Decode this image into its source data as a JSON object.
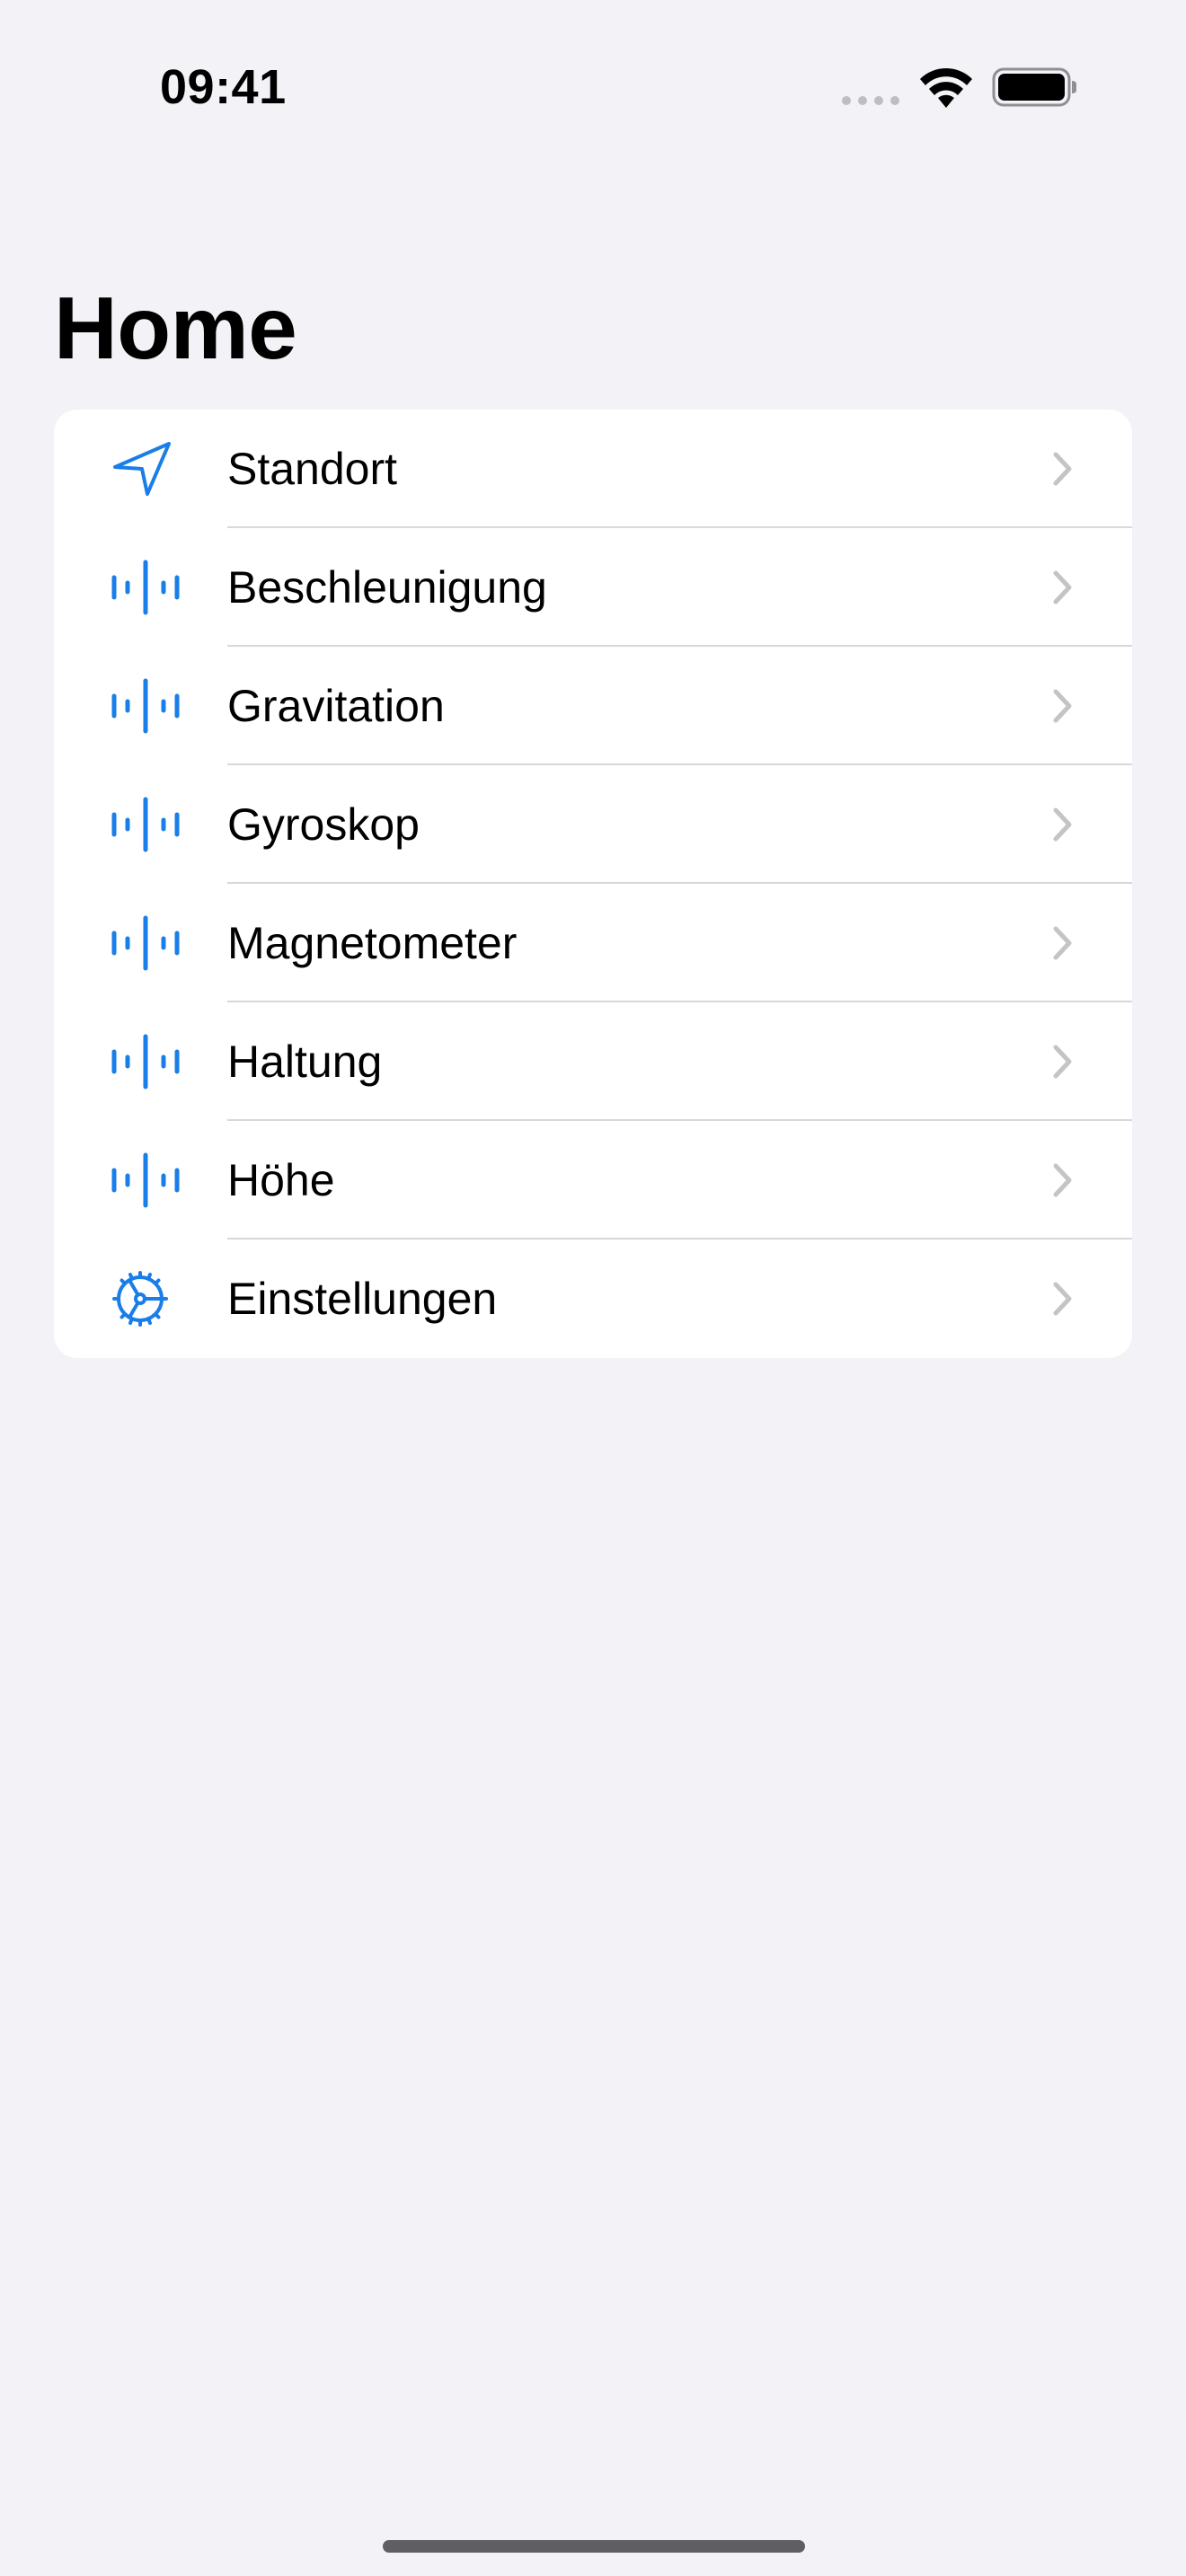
{
  "status_bar": {
    "time": "09:41"
  },
  "title": "Home",
  "colors": {
    "accent": "#1A7EE8",
    "background": "#F2F2F7",
    "card": "#FFFFFF",
    "chevron": "#C4C4C7",
    "divider": "#D7D7DC"
  },
  "items": [
    {
      "label": "Standort",
      "icon": "location-arrow-icon"
    },
    {
      "label": "Beschleunigung",
      "icon": "waveform-icon"
    },
    {
      "label": "Gravitation",
      "icon": "waveform-icon"
    },
    {
      "label": "Gyroskop",
      "icon": "waveform-icon"
    },
    {
      "label": "Magnetometer",
      "icon": "waveform-icon"
    },
    {
      "label": "Haltung",
      "icon": "waveform-icon"
    },
    {
      "label": "Höhe",
      "icon": "waveform-icon"
    },
    {
      "label": "Einstellungen",
      "icon": "gear-icon"
    }
  ]
}
